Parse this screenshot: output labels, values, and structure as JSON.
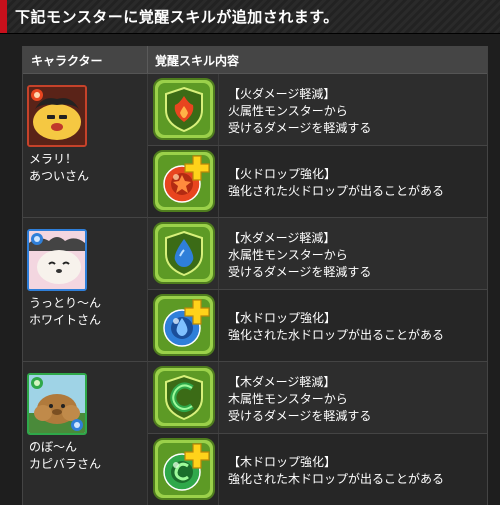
{
  "header": {
    "title": "下記モンスターに覚醒スキルが追加されます。"
  },
  "table": {
    "col_character": "キャラクター",
    "col_skill": "覚醒スキル内容",
    "rows": [
      {
        "character": {
          "name_line1": "メラリ！",
          "name_line2": "あついさん",
          "attribute": "fire"
        },
        "skills": [
          {
            "name": "【火ダメージ軽減】",
            "desc_line1": "火属性モンスターから",
            "desc_line2": "受けるダメージを軽減する",
            "icon": "fire-damage-reduction-icon"
          },
          {
            "name": "【火ドロップ強化】",
            "desc_line1": "強化された火ドロップが出ることがある",
            "desc_line2": "",
            "icon": "fire-orb-enhance-icon"
          }
        ]
      },
      {
        "character": {
          "name_line1": "うっとり～ん",
          "name_line2": "ホワイトさん",
          "attribute": "water"
        },
        "skills": [
          {
            "name": "【水ダメージ軽減】",
            "desc_line1": "水属性モンスターから",
            "desc_line2": "受けるダメージを軽減する",
            "icon": "water-damage-reduction-icon"
          },
          {
            "name": "【水ドロップ強化】",
            "desc_line1": "強化された水ドロップが出ることがある",
            "desc_line2": "",
            "icon": "water-orb-enhance-icon"
          }
        ]
      },
      {
        "character": {
          "name_line1": "のぼ～ん",
          "name_line2": "カピバラさん",
          "attribute": "wood"
        },
        "skills": [
          {
            "name": "【木ダメージ軽減】",
            "desc_line1": "木属性モンスターから",
            "desc_line2": "受けるダメージを軽減する",
            "icon": "wood-damage-reduction-icon"
          },
          {
            "name": "【木ドロップ強化】",
            "desc_line1": "強化された木ドロップが出ることがある",
            "desc_line2": "",
            "icon": "wood-orb-enhance-icon"
          }
        ]
      }
    ]
  },
  "colors": {
    "accent_red": "#c8101c",
    "fire": "#e8451f",
    "water": "#2f7fd9",
    "wood": "#2fa84a",
    "badge_green": "#9bd14a",
    "plus_yellow": "#ffd21a"
  }
}
